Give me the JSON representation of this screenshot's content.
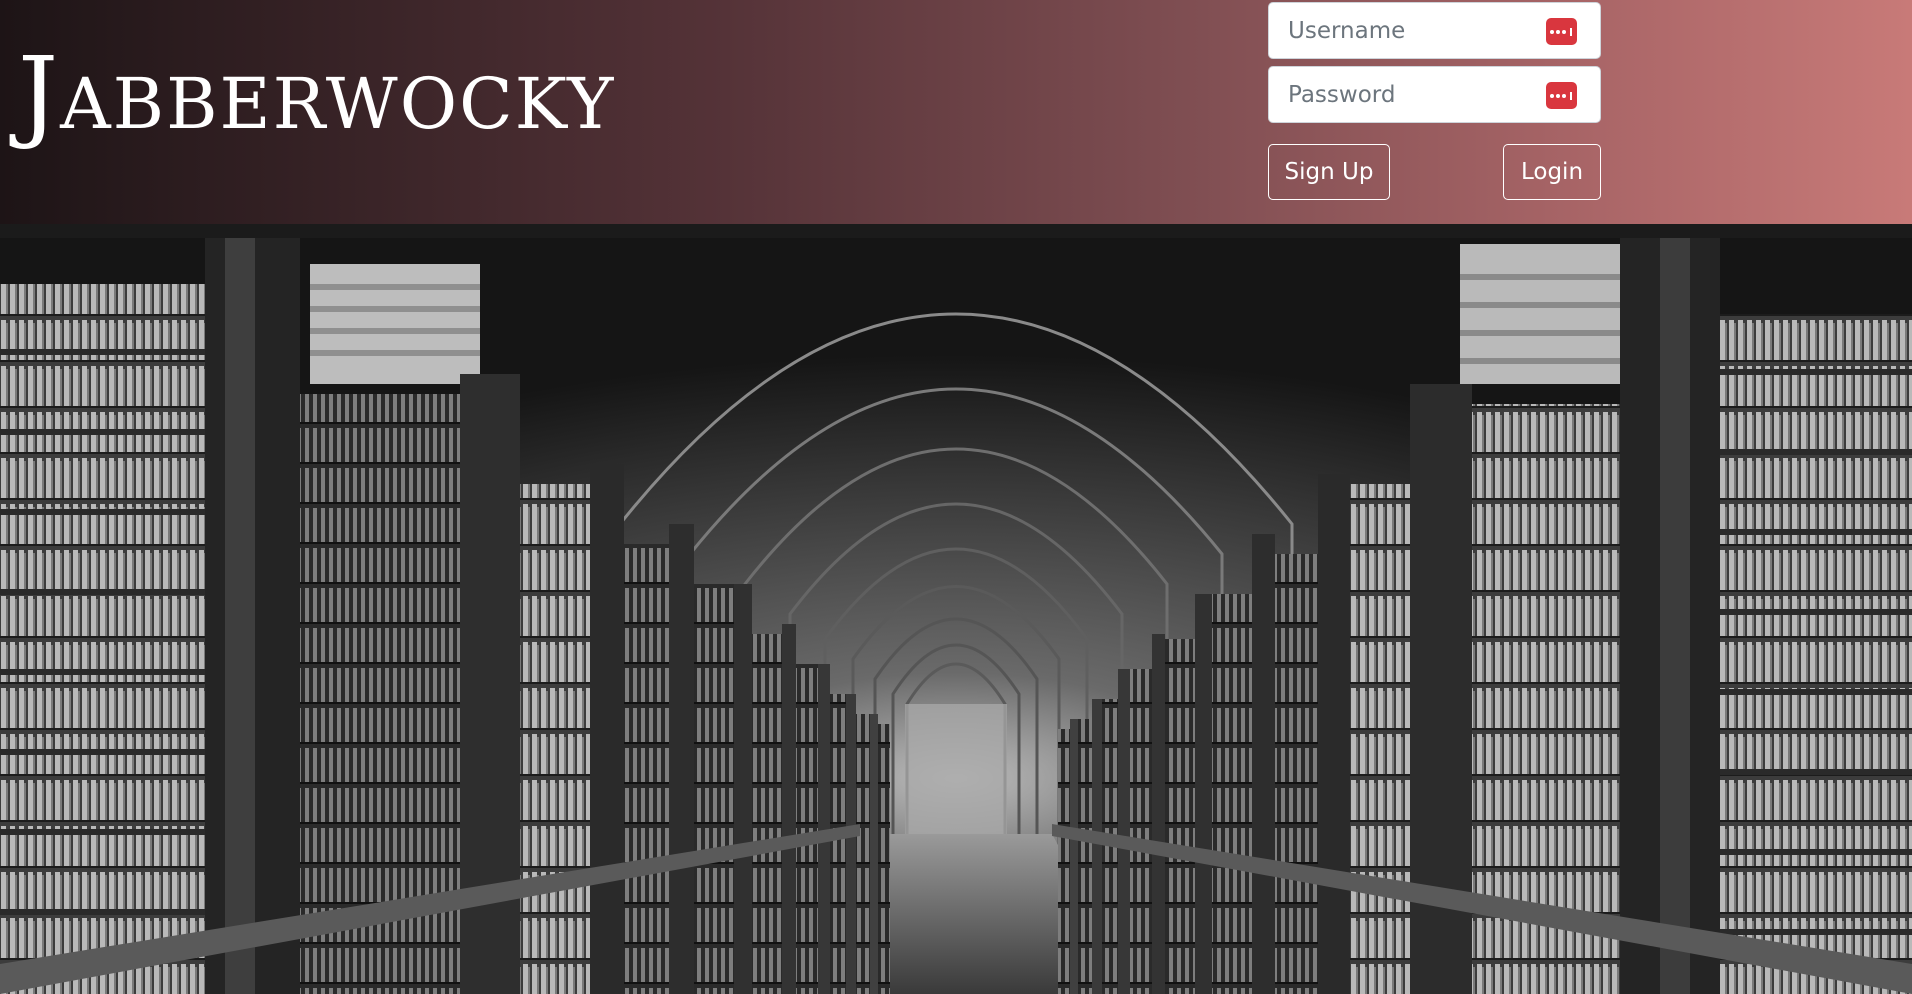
{
  "app": {
    "title": "Jabberwocky"
  },
  "login": {
    "username_placeholder": "Username",
    "password_placeholder": "Password",
    "signup_label": "Sign Up",
    "login_label": "Login",
    "field_icon": "password-manager-icon",
    "icon_color": "#d9363e"
  },
  "hero": {
    "description": "library-hall-photo"
  }
}
